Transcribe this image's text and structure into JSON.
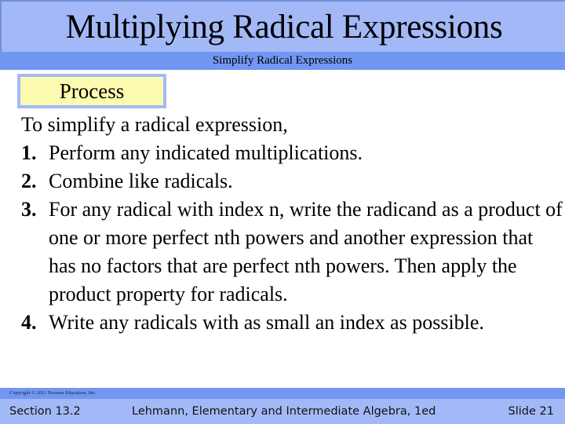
{
  "slide": {
    "title": "Multiplying Radical Expressions",
    "subtitle": "Simplify Radical Expressions",
    "label_box": "Process",
    "intro": "To simplify a radical expression,",
    "steps": [
      {
        "number": "1.",
        "text": "Perform any indicated multiplications."
      },
      {
        "number": "2.",
        "text": "Combine like radicals."
      },
      {
        "number": "3.",
        "text": "For any radical with index n, write the radicand as a product of one or more perfect nth powers and another expression that has no factors that are perfect nth powers. Then apply the product property for radicals."
      },
      {
        "number": "4.",
        "text": "Write any radicals with as small an index as possible."
      }
    ]
  },
  "footer": {
    "copyright": "Copyright © 2011 Pearson Education, Inc.",
    "section": "Section 13.2",
    "book": "Lehmann, Elementary and Intermediate Algebra, 1ed",
    "slide_number": "Slide 21"
  },
  "colors": {
    "title_band": "#a3b9f7",
    "subtitle_band": "#7197f2",
    "label_box_fill": "#fcfbb0",
    "label_box_border": "#a3b9f7"
  }
}
